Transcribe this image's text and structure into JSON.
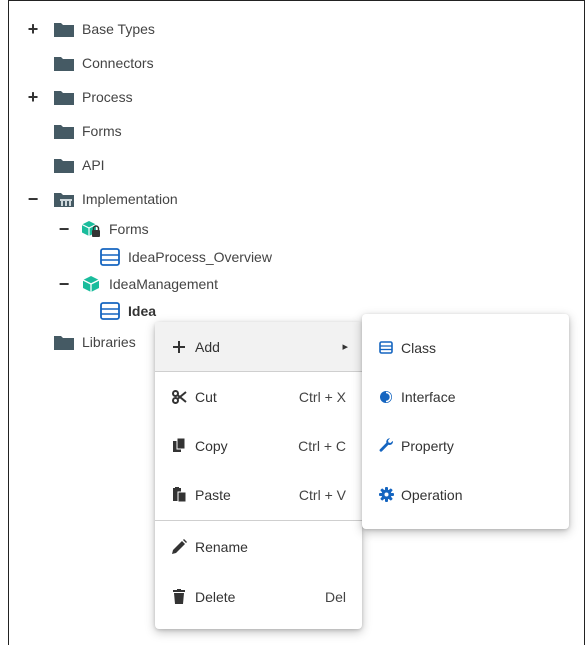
{
  "tree": {
    "items": [
      {
        "label": "Base Types",
        "toggle": "+",
        "icon": "folder-icon"
      },
      {
        "label": "Connectors",
        "toggle": "",
        "icon": "folder-icon"
      },
      {
        "label": "Process",
        "toggle": "+",
        "icon": "folder-icon"
      },
      {
        "label": "Forms",
        "toggle": "",
        "icon": "folder-icon"
      },
      {
        "label": "API",
        "toggle": "",
        "icon": "folder-icon"
      },
      {
        "label": "Implementation",
        "toggle": "−",
        "icon": "library-folder-icon"
      },
      {
        "label": "Forms",
        "toggle": "−",
        "icon": "locked-package-icon"
      },
      {
        "label": "IdeaProcess_Overview",
        "toggle": "",
        "icon": "class-icon"
      },
      {
        "label": "IdeaManagement",
        "toggle": "−",
        "icon": "package-icon"
      },
      {
        "label": "Idea",
        "toggle": "",
        "icon": "class-icon"
      },
      {
        "label": "Libraries",
        "toggle": "",
        "icon": "folder-icon"
      }
    ]
  },
  "context_menu": {
    "items": [
      {
        "label": "Add",
        "shortcut": "",
        "icon": "plus-icon"
      },
      {
        "label": "Cut",
        "shortcut": "Ctrl + X",
        "icon": "scissors-icon"
      },
      {
        "label": "Copy",
        "shortcut": "Ctrl + C",
        "icon": "copy-icon"
      },
      {
        "label": "Paste",
        "shortcut": "Ctrl + V",
        "icon": "paste-icon"
      },
      {
        "label": "Rename",
        "shortcut": "",
        "icon": "pencil-icon"
      },
      {
        "label": "Delete",
        "shortcut": "Del",
        "icon": "trash-icon"
      }
    ],
    "submenu_arrow": "▸"
  },
  "submenu": {
    "items": [
      {
        "label": "Class",
        "icon": "class-icon"
      },
      {
        "label": "Interface",
        "icon": "interface-icon"
      },
      {
        "label": "Property",
        "icon": "wrench-icon"
      },
      {
        "label": "Operation",
        "icon": "gear-icon"
      }
    ]
  },
  "colors": {
    "folder": "#455a64",
    "package": "#1abc9c",
    "class": "#1565c0",
    "highlight": "#f2f2f2"
  }
}
